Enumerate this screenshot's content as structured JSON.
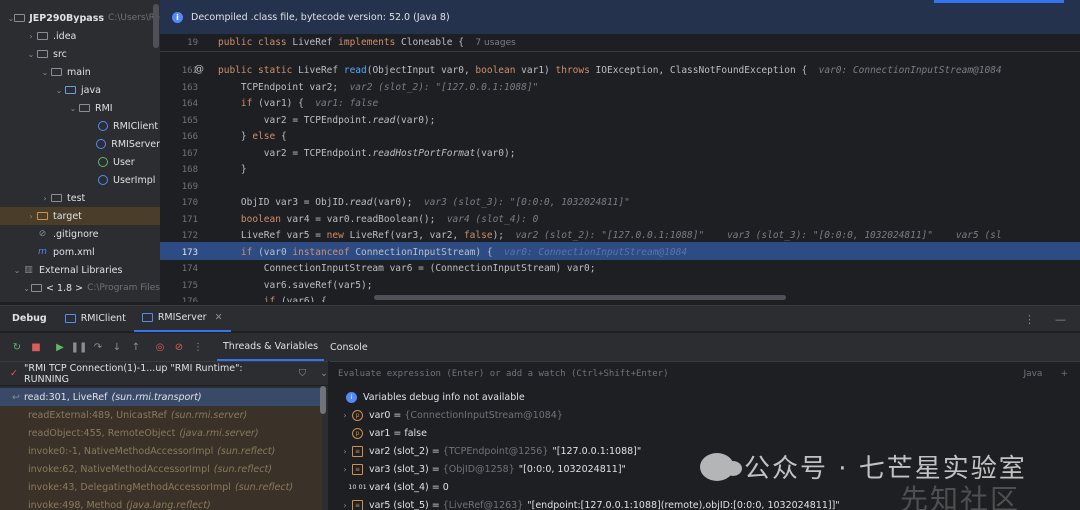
{
  "project_tree": [
    {
      "label": "JEP290Bypass",
      "dim": "C:\\Users\\Re",
      "bold": true,
      "icon": "folder-icon",
      "chev": "v"
    },
    {
      "label": ".idea",
      "icon": "folder-icon",
      "chev": ">"
    },
    {
      "label": "src",
      "icon": "folder-icon",
      "chev": "v"
    },
    {
      "label": "main",
      "icon": "folder-icon",
      "chev": "v"
    },
    {
      "label": "java",
      "icon": "source-folder-icon",
      "chev": "v"
    },
    {
      "label": "RMI",
      "icon": "package-icon",
      "chev": "v"
    },
    {
      "label": "RMIClient",
      "icon": "class-icon"
    },
    {
      "label": "RMIServer",
      "icon": "class-icon"
    },
    {
      "label": "User",
      "icon": "interface-icon"
    },
    {
      "label": "UserImpl",
      "icon": "class-icon"
    },
    {
      "label": "test",
      "icon": "folder-icon",
      "chev": ">"
    },
    {
      "label": "target",
      "icon": "excluded-folder-icon",
      "chev": ">"
    },
    {
      "label": ".gitignore",
      "icon": "file-icon"
    },
    {
      "label": "pom.xml",
      "icon": "maven-icon"
    },
    {
      "label": "External Libraries",
      "icon": "library-icon",
      "chev": "v"
    },
    {
      "label": "< 1.8 >",
      "dim": "C:\\Program Files",
      "icon": "sdk-icon",
      "chev": "v"
    }
  ],
  "banner": {
    "text": "Decompiled .class file, bytecode version: 52.0 (Java 8)"
  },
  "sticky": {
    "line": "19",
    "code": "public class LiveRef implements Cloneable {",
    "usages": "7 usages"
  },
  "code_lines": [
    {
      "n": "162",
      "html": "<span class='kw'>public static</span> LiveRef <span class='fn'>read</span>(ObjectInput var0, <span class='kw'>boolean</span> var1) <span class='kw'>throws</span> IOException, ClassNotFoundException {  <span class='hint'>var0: ConnectionInputStream@1084</span>"
    },
    {
      "n": "163",
      "html": "    TCPEndpoint var2;  <span class='hint'>var2 (slot_2): \"[127.0.0.1:1088]\"</span>"
    },
    {
      "n": "164",
      "html": "    <span class='kw'>if</span> (var1) {  <span class='hint'>var1: false</span>"
    },
    {
      "n": "165",
      "html": "        var2 = TCPEndpoint.<span class='it'>read</span>(var0);"
    },
    {
      "n": "166",
      "html": "    } <span class='kw'>else</span> {"
    },
    {
      "n": "167",
      "html": "        var2 = TCPEndpoint.<span class='it'>readHostPortFormat</span>(var0);"
    },
    {
      "n": "168",
      "html": "    }"
    },
    {
      "n": "169",
      "html": ""
    },
    {
      "n": "170",
      "html": "    ObjID var3 = ObjID.<span class='it'>read</span>(var0);  <span class='hint'>var3 (slot_3): \"[0:0:0, 1032024811]\"</span>"
    },
    {
      "n": "171",
      "html": "    <span class='kw'>boolean</span> var4 = var0.readBoolean();  <span class='hint'>var4 (slot_4): 0</span>"
    },
    {
      "n": "172",
      "html": "    LiveRef var5 = <span class='kw'>new</span> LiveRef(var3, var2, <span class='kw'>false</span>);  <span class='hint'>var2 (slot_2): \"[127.0.0.1:1088]\"    var3 (slot_3): \"[0:0:0, 1032024811]\"    var5 (sl</span>"
    },
    {
      "n": "173",
      "html": "    <span class='kw'>if</span> (var0 <span class='kw'>instanceof</span> ConnectionInputStream) {  <span class='hl-text it'>var0: ConnectionInputStream@1084</span>"
    },
    {
      "n": "174",
      "html": "        ConnectionInputStream var6 = (ConnectionInputStream) var0;"
    },
    {
      "n": "175",
      "html": "        var6.saveRef(var5);"
    },
    {
      "n": "176",
      "html": "        <span class='kw'>if</span> (var6) {"
    }
  ],
  "debug_bar": {
    "title": "Debug",
    "tab1": "RMIClient",
    "tab2": "RMIServer"
  },
  "subtabs": {
    "threads": "Threads & Variables",
    "console": "Console"
  },
  "thread": {
    "label": "\"RMI TCP Connection(1)-1...up \"RMI Runtime\": RUNNING"
  },
  "eval": {
    "placeholder": "Evaluate expression (Enter) or add a watch (Ctrl+Shift+Enter)",
    "lang": "Java"
  },
  "frames": [
    {
      "method": "read:301, LiveRef",
      "pkg": "(sun.rmi.transport)",
      "sel": true
    },
    {
      "method": "readExternal:489, UnicastRef",
      "pkg": "(sun.rmi.server)"
    },
    {
      "method": "readObject:455, RemoteObject",
      "pkg": "(java.rmi.server)"
    },
    {
      "method": "invoke0:-1, NativeMethodAccessorImpl",
      "pkg": "(sun.reflect)"
    },
    {
      "method": "invoke:62, NativeMethodAccessorImpl",
      "pkg": "(sun.reflect)"
    },
    {
      "method": "invoke:43, DelegatingMethodAccessorImpl",
      "pkg": "(sun.reflect)"
    },
    {
      "method": "invoke:498, Method",
      "pkg": "(java.lang.reflect)"
    }
  ],
  "variables": [
    {
      "icon": "info",
      "name": "Variables debug info not available",
      "ref": "",
      "val": ""
    },
    {
      "icon": "p",
      "exp": ">",
      "name": "var0",
      "ref": "{ConnectionInputStream@1084}",
      "val": ""
    },
    {
      "icon": "p",
      "name": "var1",
      "ref": "",
      "val": "false"
    },
    {
      "icon": "stack",
      "exp": ">",
      "name": "var2 (slot_2)",
      "ref": "{TCPEndpoint@1256}",
      "val": "\"[127.0.0.1:1088]\""
    },
    {
      "icon": "stack",
      "exp": ">",
      "name": "var3 (slot_3)",
      "ref": "{ObjID@1258}",
      "val": "\"[0:0:0, 1032024811]\""
    },
    {
      "icon": "bits",
      "name": "var4 (slot_4)",
      "ref": "",
      "val": "0"
    },
    {
      "icon": "stack",
      "exp": ">",
      "name": "var5 (slot_5)",
      "ref": "{LiveRef@1263}",
      "val": "\"[endpoint:[127.0.0.1:1088](remote),objID:[0:0:0, 1032024811]]\""
    }
  ],
  "watermark": {
    "text": "公众号 · 七芒星实验室",
    "site": "先知社区"
  }
}
